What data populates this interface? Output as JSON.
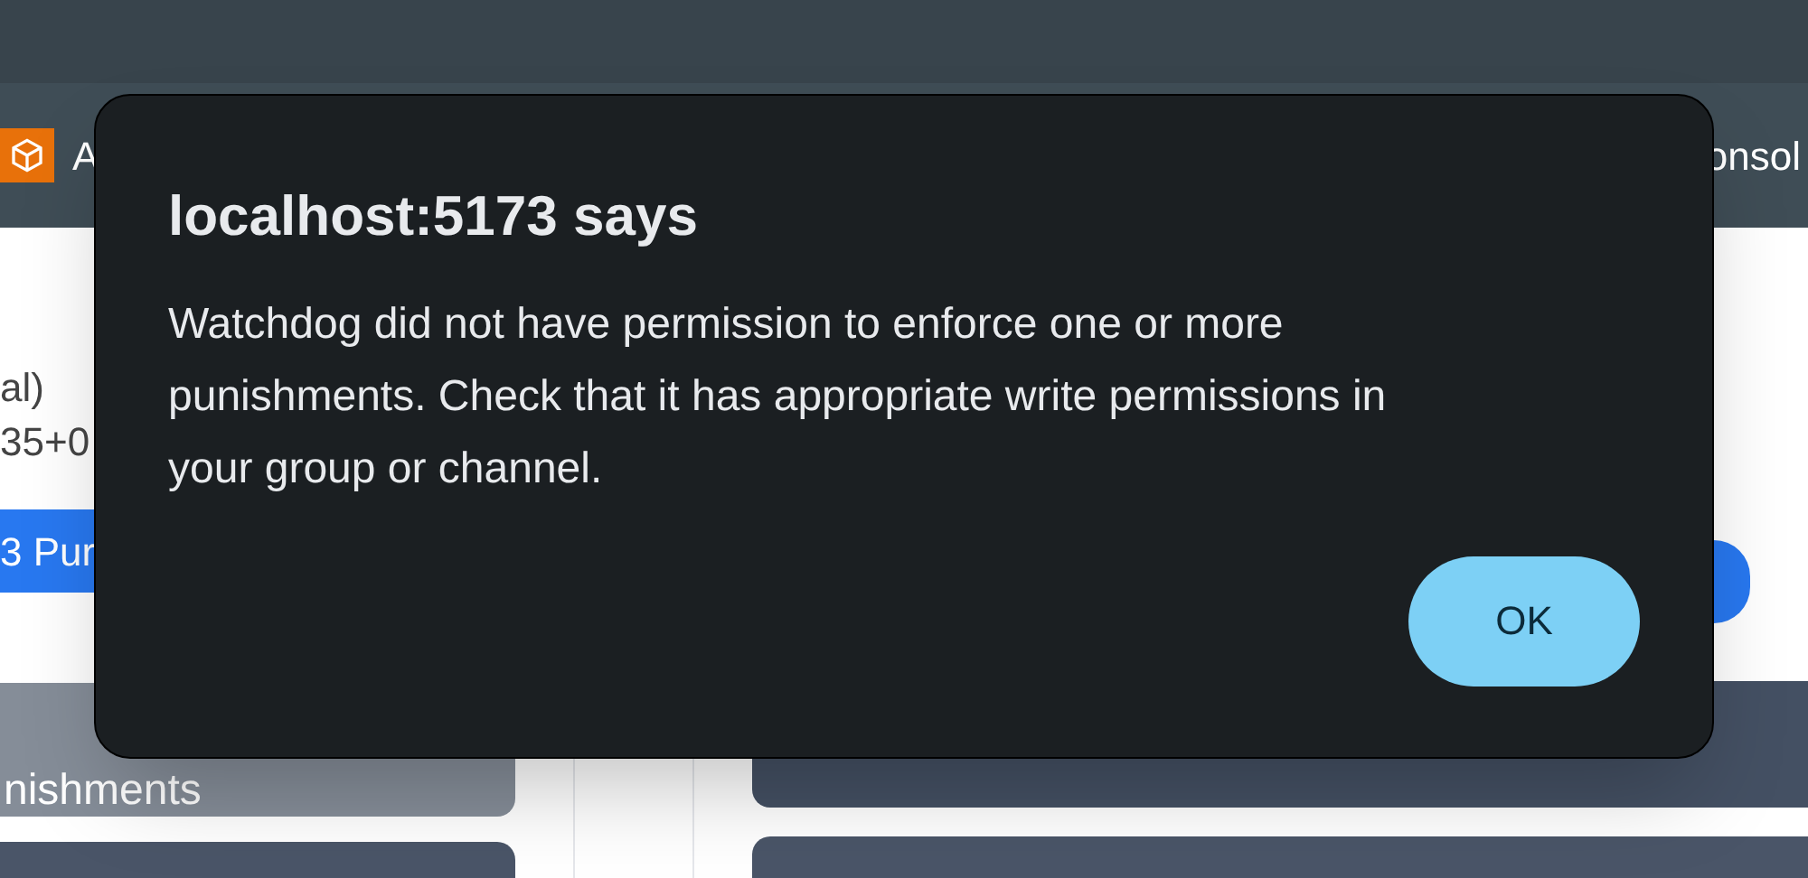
{
  "page": {
    "header_text": "A",
    "header_right_text": "onsol",
    "details": [
      "al)",
      "35+0"
    ],
    "punish_button": "3 Pur",
    "punishments_button": "nishments"
  },
  "dialog": {
    "title": "localhost:5173 says",
    "message": "Watchdog did not have permission to enforce one or more punishments. Check that it has appropriate write permissions in your group or channel.",
    "ok_button": "OK"
  }
}
